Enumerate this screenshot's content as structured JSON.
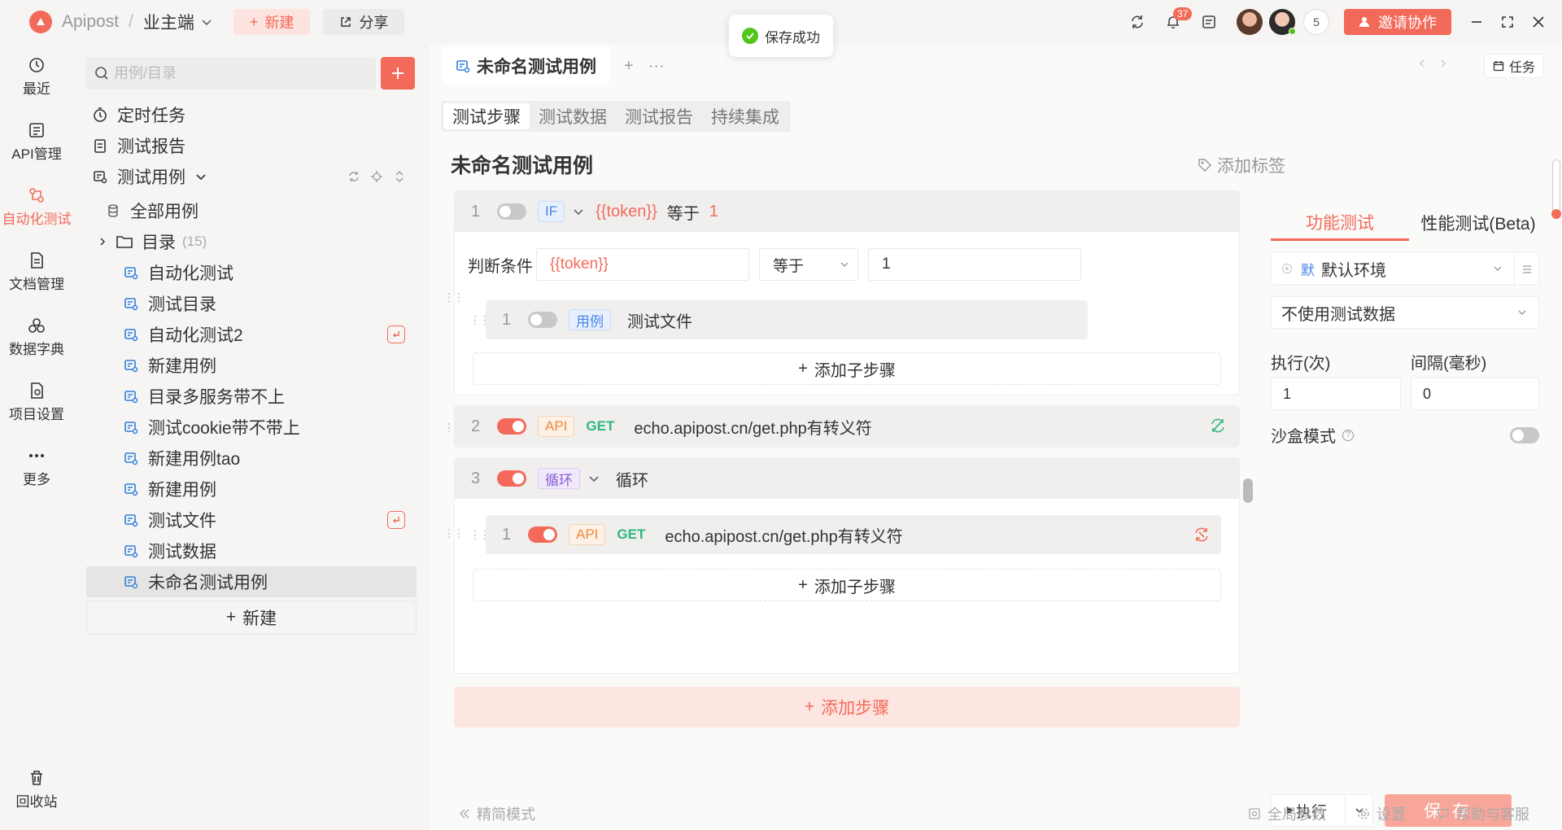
{
  "app": {
    "brand": "Apipost",
    "workspace": "业主端"
  },
  "toolbar": {
    "new_label": "新建",
    "share_label": "分享",
    "invite_label": "邀请协作",
    "notif_count": "37",
    "member_count": "5"
  },
  "toast": {
    "message": "保存成功"
  },
  "nav": {
    "items": [
      {
        "label": "最近",
        "icon": "history-icon"
      },
      {
        "label": "API管理",
        "icon": "api-icon"
      },
      {
        "label": "自动化测试",
        "icon": "automation-icon"
      },
      {
        "label": "文档管理",
        "icon": "document-icon"
      },
      {
        "label": "数据字典",
        "icon": "dictionary-icon"
      },
      {
        "label": "项目设置",
        "icon": "settings-icon"
      },
      {
        "label": "更多",
        "icon": "more-icon"
      }
    ],
    "trash": "回收站"
  },
  "sidebar": {
    "search_placeholder": "用例/目录",
    "top": [
      {
        "label": "定时任务"
      },
      {
        "label": "测试报告"
      },
      {
        "label": "测试用例"
      }
    ],
    "all_cases": "全部用例",
    "folder": {
      "label": "目录",
      "count": "(15)"
    },
    "cases": [
      {
        "label": "自动化测试"
      },
      {
        "label": "测试目录"
      },
      {
        "label": "自动化测试2"
      },
      {
        "label": "新建用例"
      },
      {
        "label": "目录多服务带不上"
      },
      {
        "label": "测试cookie带不带上"
      },
      {
        "label": "新建用例tao"
      },
      {
        "label": "新建用例"
      },
      {
        "label": "测试文件"
      },
      {
        "label": "测试数据"
      },
      {
        "label": "未命名测试用例"
      }
    ],
    "new_label": "新建"
  },
  "main": {
    "tab_title": "未命名测试用例",
    "task_label": "任务",
    "subtabs": [
      "测试步骤",
      "测试数据",
      "测试报告",
      "持续集成"
    ],
    "case_title": "未命名测试用例",
    "add_tag": "添加标签",
    "step1": {
      "num": "1",
      "tag": "IF",
      "var": "{{token}}",
      "op": "等于",
      "val": "1",
      "cond_label": "判断条件",
      "cond_var": "{{token}}",
      "cond_op": "等于",
      "cond_val": "1",
      "child": {
        "num": "1",
        "tag": "用例",
        "label": "测试文件"
      },
      "add_child": "添加子步骤"
    },
    "step2": {
      "num": "2",
      "tag": "API",
      "method": "GET",
      "url": "echo.apipost.cn/get.php有转义符"
    },
    "step3": {
      "num": "3",
      "tag": "循环",
      "label": "循环",
      "child": {
        "num": "1",
        "tag": "API",
        "method": "GET",
        "url": "echo.apipost.cn/get.php有转义符"
      },
      "add_child": "添加子步骤"
    },
    "add_step": "添加步骤"
  },
  "right": {
    "tabs": [
      "功能测试",
      "性能测试(Beta)"
    ],
    "env_badge": "默",
    "env": "默认环境",
    "data_select": "不使用测试数据",
    "exec_label": "执行(次)",
    "interval_label": "间隔(毫秒)",
    "exec_value": "1",
    "interval_value": "0",
    "sandbox_label": "沙盒模式",
    "run_label": "执行",
    "save_label": "保 存"
  },
  "bottom": {
    "simple_mode": "精简模式",
    "global_params": "全局参数",
    "settings": "设置",
    "help": "帮助与客服"
  },
  "colors": {
    "accent": "#f36a5a",
    "get": "#2fb67c",
    "success": "#52c41a"
  }
}
